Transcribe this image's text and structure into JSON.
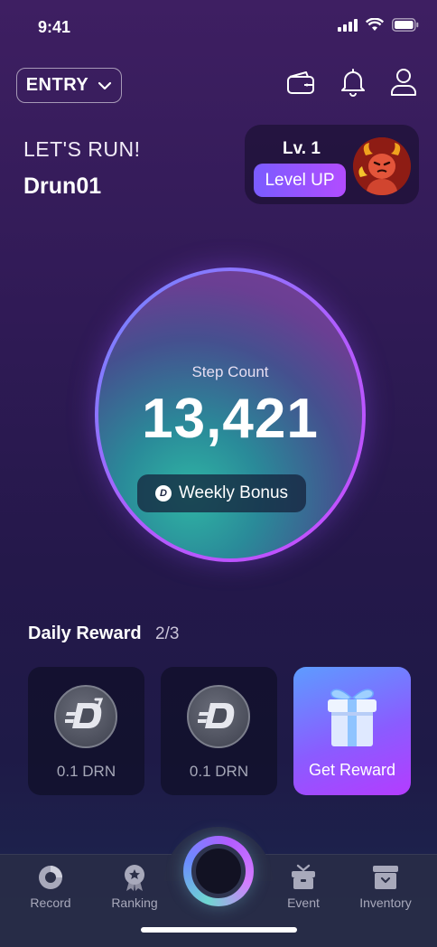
{
  "status_bar": {
    "time": "9:41"
  },
  "header": {
    "entry_label": "ENTRY"
  },
  "greeting": {
    "headline": "LET'S RUN!",
    "username": "Drun01"
  },
  "level": {
    "label": "Lv. 1",
    "button_label": "Level UP"
  },
  "steps": {
    "label": "Step Count",
    "count": "13,421",
    "bonus_label": "Weekly Bonus"
  },
  "daily_reward": {
    "title": "Daily Reward",
    "progress": "2/3",
    "items": [
      {
        "label": "0.1 DRN"
      },
      {
        "label": "0.1 DRN"
      }
    ],
    "get_reward_label": "Get Reward"
  },
  "nav": {
    "record": "Record",
    "ranking": "Ranking",
    "event": "Event",
    "inventory": "Inventory"
  },
  "colors": {
    "accent_purple": "#b24cff",
    "accent_blue": "#7a5cff",
    "ring_teal": "#2fb5a4"
  },
  "icons": [
    "signal-icon",
    "wifi-icon",
    "battery-icon",
    "chevron-down-icon",
    "wallet-icon",
    "bell-icon",
    "user-icon",
    "drn-coin-icon",
    "gift-icon",
    "record-icon",
    "ranking-icon",
    "event-icon",
    "inventory-icon"
  ]
}
